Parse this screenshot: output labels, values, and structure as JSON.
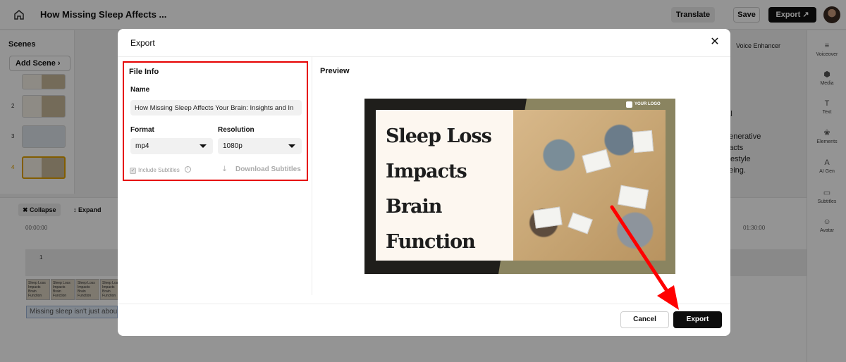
{
  "app": {
    "project_title": "How Missing Sleep Affects ...",
    "translate_label": "Translate",
    "save_label": "Save",
    "export_label": "Export"
  },
  "scenes": {
    "label": "Scenes",
    "add_label": "Add Scene",
    "numbers": [
      "2",
      "3",
      "4"
    ]
  },
  "right_panel": {
    "voice_enhancer": "Voice Enhancer",
    "items": [
      "Voiceover",
      "Media",
      "Text",
      "Elements",
      "AI Gen",
      "Subtitles",
      "Avatar"
    ]
  },
  "side_snippets": [
    "onal",
    "generative",
    "pacts",
    "lifestyle",
    "being."
  ],
  "timeline": {
    "collapse_label": "Collapse",
    "expand_label": "Expand",
    "time_start": "00:00:00",
    "time_end": "01:30:00",
    "track_number": "1",
    "subtitle_clip": "Missing sleep isn't just about"
  },
  "modal": {
    "title": "Export",
    "file_info_title": "File Info",
    "name_label": "Name",
    "name_value": "How Missing Sleep Affects Your Brain: Insights and In",
    "format_label": "Format",
    "format_value": "mp4",
    "resolution_label": "Resolution",
    "resolution_value": "1080p",
    "include_subtitles": "Include Subtitles",
    "download_subtitles": "Download Subtitles",
    "preview_label": "Preview",
    "preview_logo": "YOUR LOGO",
    "preview_lines": [
      "Sleep Loss",
      "Impacts",
      "Brain",
      "Function"
    ],
    "cancel_label": "Cancel",
    "export_label": "Export"
  },
  "colors": {
    "highlight": "#e60000",
    "primary": "#0d0d0d",
    "preview_olive": "#8a8460"
  }
}
